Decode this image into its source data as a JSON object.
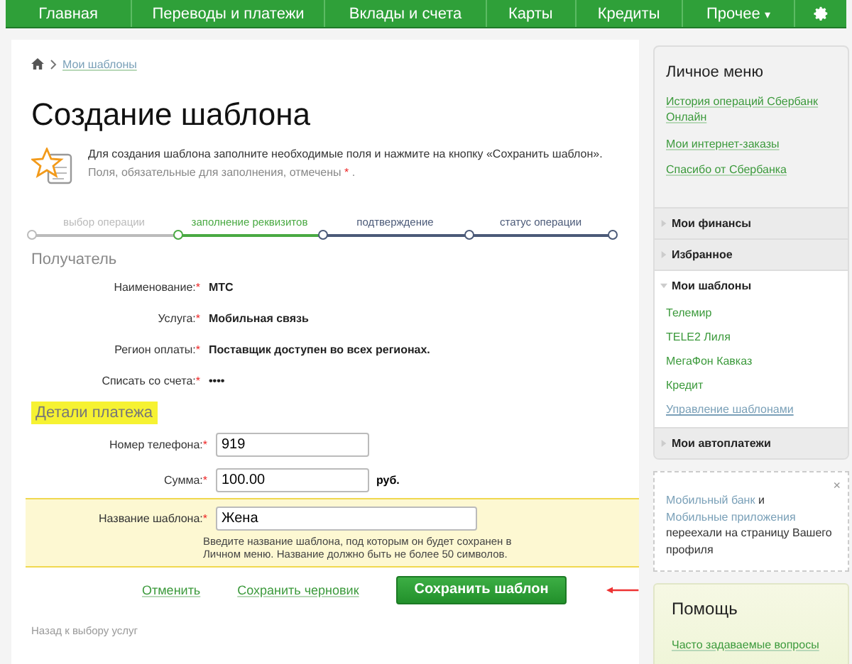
{
  "nav": [
    {
      "label": "Главная"
    },
    {
      "label": "Переводы и платежи"
    },
    {
      "label": "Вклады и счета"
    },
    {
      "label": "Карты"
    },
    {
      "label": "Кредиты"
    },
    {
      "label": "Прочее",
      "caret": "▾"
    }
  ],
  "breadcrumb": {
    "link": "Мои шаблоны"
  },
  "title": "Создание шаблона",
  "info": {
    "text": "Для создания шаблона заполните необходимые поля и нажмите на кнопку «Сохранить шаблон».",
    "required_note": "Поля, обязательные для заполнения, отмечены",
    "required_mark": "*",
    "tail": "."
  },
  "steps": [
    {
      "label": "выбор операции",
      "done": true,
      "selected": false
    },
    {
      "label": "заполнение реквизитов",
      "done": false,
      "selected": true
    },
    {
      "label": "подтверждение",
      "done": false,
      "selected": false
    },
    {
      "label": "статус операции",
      "done": false,
      "selected": false
    }
  ],
  "recipient": {
    "heading": "Получатель",
    "rows": [
      {
        "label": "Наименование:",
        "value": "МТС"
      },
      {
        "label": "Услуга:",
        "value": "Мобильная связь"
      },
      {
        "label": "Регион оплаты:",
        "value": "Поставщик доступен во всех регионах."
      },
      {
        "label": "Списать со счета:",
        "value": "••••"
      }
    ]
  },
  "details": {
    "heading": "Детали платежа",
    "fields": [
      {
        "label": "Номер телефона:",
        "value": "919",
        "highlighted": false
      },
      {
        "label": "Сумма:",
        "value": "100.00",
        "unit": "руб.",
        "highlighted": false
      },
      {
        "label": "Название шаблона:",
        "value": "Жена",
        "highlighted": true,
        "hint": "Введите название шаблона, под которым он будет сохранен в Личном меню. Название должно быть не более 50 символов."
      }
    ]
  },
  "actions": {
    "cancel": "Отменить",
    "draft": "Сохранить черновик",
    "save": "Сохранить шаблон"
  },
  "back_link": "Назад к выбору услуг",
  "sidebar": {
    "title": "Личное меню",
    "links": [
      "История операций Сбербанк Онлайн",
      "Мои интернет-заказы",
      "Спасибо от Сбербанка"
    ],
    "sections": [
      {
        "label": "Мои финансы",
        "expanded": false
      },
      {
        "label": "Избранное",
        "expanded": false
      },
      {
        "label": "Мои шаблоны",
        "expanded": true,
        "children": [
          {
            "label": "Телемир",
            "kind": "item"
          },
          {
            "label": "TELE2 Лиля",
            "kind": "item"
          },
          {
            "label": "МегаФон Кавказ",
            "kind": "item"
          },
          {
            "label": "Кредит",
            "kind": "item"
          },
          {
            "label": "Управление шаблонами",
            "kind": "manage"
          }
        ]
      },
      {
        "label": "Мои автоплатежи",
        "expanded": false
      }
    ],
    "notice": {
      "link1": "Мобильный банк",
      "and": "и",
      "link2": "Мобильные приложения",
      "text": "переехали на страницу Вашего профиля",
      "close": "×"
    },
    "help": {
      "title": "Помощь",
      "link": "Часто задаваемые вопросы"
    }
  }
}
